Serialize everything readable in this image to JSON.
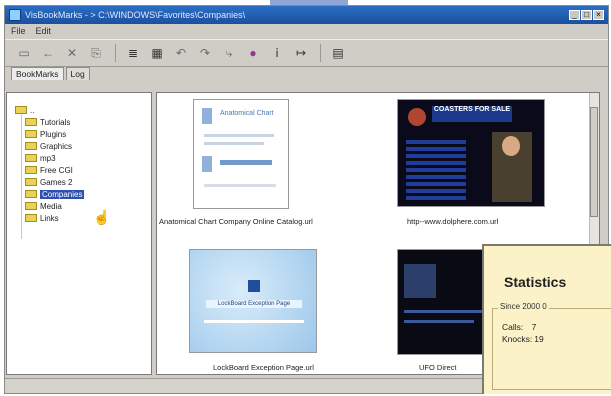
{
  "window": {
    "title": "VisBookMarks - > C:\\WINDOWS\\Favorites\\Companies\\"
  },
  "menu": [
    "File",
    "Edit"
  ],
  "tabs": [
    "BookMarks",
    "Log"
  ],
  "tree": [
    {
      "label": "..",
      "selected": false
    },
    {
      "label": "Tutorials",
      "selected": false
    },
    {
      "label": "Plugins",
      "selected": false
    },
    {
      "label": "Graphics",
      "selected": false
    },
    {
      "label": "mp3",
      "selected": false
    },
    {
      "label": "Free CGI",
      "selected": false
    },
    {
      "label": "Games 2",
      "selected": false
    },
    {
      "label": "Companies",
      "selected": true
    },
    {
      "label": "Media",
      "selected": false
    },
    {
      "label": "Links",
      "selected": false
    }
  ],
  "thumbnails": [
    {
      "caption": "Anatomical Chart Company Online Catalog.url",
      "thumb_text": "Anatomical Chart"
    },
    {
      "caption": "http--www.dolphere.com.url",
      "thumb_text": "COASTERS FOR SALE"
    },
    {
      "caption": "LockBoard Exception Page.url",
      "thumb_text": "LockBoard Exception Page"
    },
    {
      "caption": "UFO Direct",
      "thumb_text": ""
    }
  ],
  "stats": {
    "title": "Statistics",
    "since": "Since 2000 0",
    "calls_label": "Calls:",
    "calls_value": "7",
    "knocks_label": "Knocks:",
    "knocks_value": "19"
  }
}
